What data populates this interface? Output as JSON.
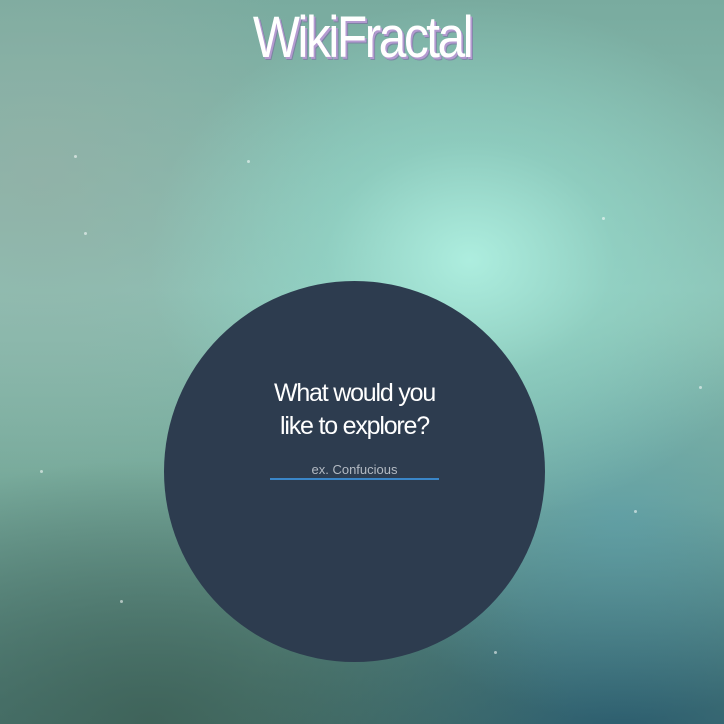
{
  "site": {
    "title": "WikiFractal"
  },
  "explore": {
    "prompt_line1": "What would you",
    "prompt_line2": "like to explore?",
    "search_placeholder": "ex. Confucious",
    "search_value": ""
  },
  "colors": {
    "circle_bg": "#2d3c4f",
    "input_underline": "#3a86c8",
    "title_shadow": "#b49ad0",
    "background_highlight": "#aff0e1"
  }
}
